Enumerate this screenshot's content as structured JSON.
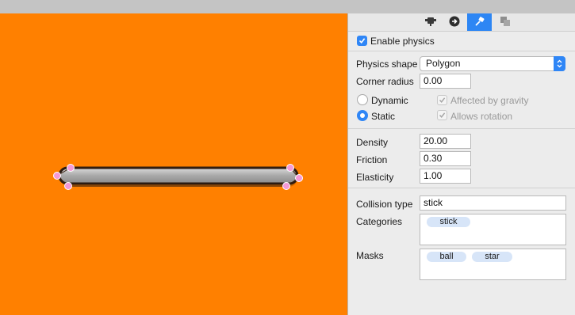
{
  "toolbar_tabs": [
    {
      "name": "physics-body-tab",
      "icon": "physics-body-icon"
    },
    {
      "name": "next-arrow-tab",
      "icon": "arrow-right-circle-icon"
    },
    {
      "name": "physics-tab",
      "icon": "physics-pin-icon",
      "active": true
    },
    {
      "name": "layers-tab",
      "icon": "layers-icon"
    }
  ],
  "physics": {
    "enable_label": "Enable physics",
    "enable_checked": true,
    "shape_label": "Physics shape",
    "shape_value": "Polygon",
    "corner_radius_label": "Corner radius",
    "corner_radius_value": "0.00",
    "body_type_dynamic_label": "Dynamic",
    "body_type_static_label": "Static",
    "body_type_selected": "Static",
    "gravity_label": "Affected by gravity",
    "gravity_checked": true,
    "rotation_label": "Allows rotation",
    "rotation_checked": true,
    "density_label": "Density",
    "density_value": "20.00",
    "friction_label": "Friction",
    "friction_value": "0.30",
    "elasticity_label": "Elasticity",
    "elasticity_value": "1.00",
    "collision_type_label": "Collision type",
    "collision_type_value": "stick",
    "categories_label": "Categories",
    "categories": [
      "stick"
    ],
    "masks_label": "Masks",
    "masks": [
      "ball",
      "star"
    ]
  },
  "colors": {
    "canvas_background": "#ff8000",
    "accent": "#2f86f6",
    "handle": "#f49ad8",
    "token_chip": "#d7e5f8"
  }
}
